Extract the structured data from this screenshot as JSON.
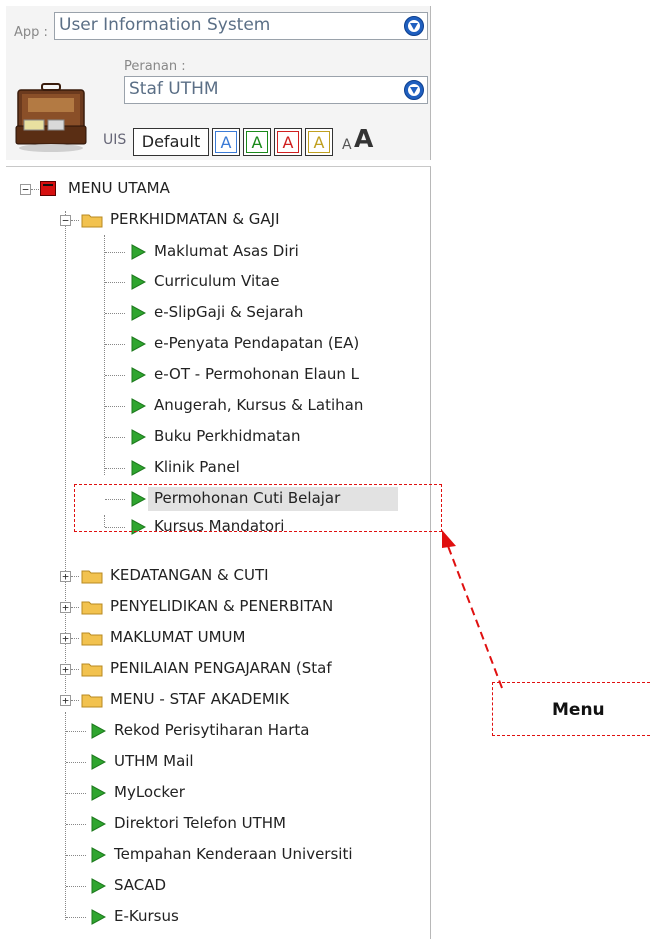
{
  "header": {
    "app_label": "App :",
    "app_value": "User Information System",
    "role_label": "Peranan :",
    "role_value": "Staf UTHM",
    "logo_text": "UIS",
    "font_buttons": [
      "Default",
      "A",
      "A",
      "A",
      "A"
    ],
    "size_small": "A",
    "size_large": "A"
  },
  "tree": {
    "root": "MENU UTAMA",
    "groups": [
      {
        "label": "PERKHIDMATAN & GAJI",
        "children": [
          "Maklumat Asas Diri",
          "Curriculum Vitae",
          "e-SlipGaji & Sejarah",
          "e-Penyata Pendapatan (EA)",
          "e-OT - Permohonan Elaun L",
          "Anugerah, Kursus & Latihan",
          "Buku Perkhidmatan",
          "Klinik Panel",
          "Permohonan Cuti Belajar",
          "Kursus Mandatori"
        ]
      },
      {
        "label": "KEDATANGAN & CUTI"
      },
      {
        "label": "PENYELIDIKAN & PENERBITAN"
      },
      {
        "label": "MAKLUMAT UMUM"
      },
      {
        "label": "PENILAIAN PENGAJARAN (Staf"
      },
      {
        "label": "MENU - STAF AKADEMIK"
      }
    ],
    "links": [
      "Rekod Perisytiharan Harta",
      "UTHM Mail",
      "MyLocker",
      "Direktori Telefon UTHM",
      "Tempahan Kenderaan Universiti",
      "SACAD",
      "E-Kursus"
    ],
    "selected": "Permohonan Cuti Belajar"
  },
  "annotation": {
    "label": "Menu"
  },
  "colors": {
    "arrow": "#2fa52f",
    "folder": "#f2c24f",
    "annotation": "#e01010",
    "font_btn_blue": "#3b7bd6",
    "font_btn_green": "#1a8a1a",
    "font_btn_red": "#d02020",
    "font_btn_yellow": "#c0a020"
  }
}
